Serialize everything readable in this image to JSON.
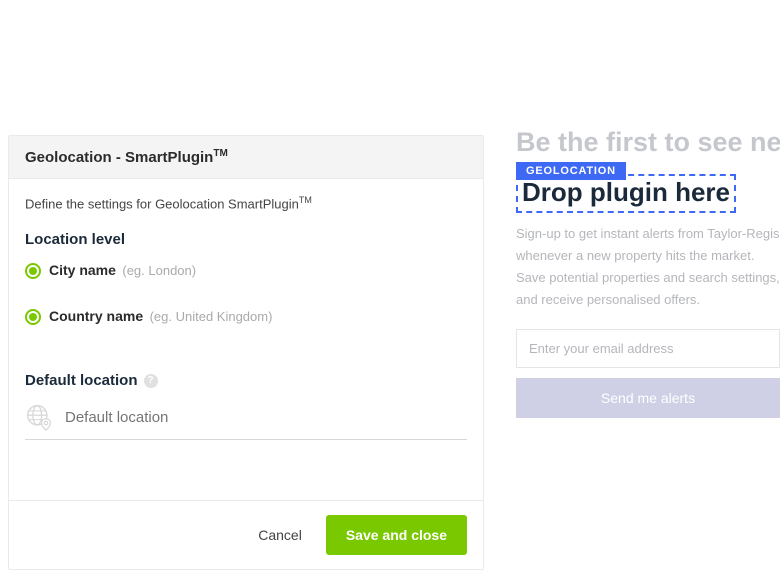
{
  "panel": {
    "title_prefix": "Geolocation - SmartPlugin",
    "title_suffix": "TM",
    "description_prefix": "Define the settings for Geolocation SmartPlugin",
    "description_suffix": "TM",
    "location_level": {
      "title": "Location level",
      "options": [
        {
          "label": "City name",
          "hint": "(eg. London)"
        },
        {
          "label": "Country name",
          "hint": "(eg. United Kingdom)"
        }
      ]
    },
    "default_location": {
      "title": "Default location",
      "placeholder": "Default location",
      "value": ""
    },
    "footer": {
      "cancel": "Cancel",
      "save": "Save and close"
    }
  },
  "preview": {
    "heading": "Be the first to see new properties in",
    "dropzone": {
      "tag": "GEOLOCATION",
      "text": "Drop plugin here"
    },
    "description": "Sign-up to get instant alerts from Taylor-Regis whenever a new property hits the market. Save potential properties and search settings, and receive personalised offers.",
    "email_placeholder": "Enter your email address",
    "button": "Send me alerts"
  }
}
